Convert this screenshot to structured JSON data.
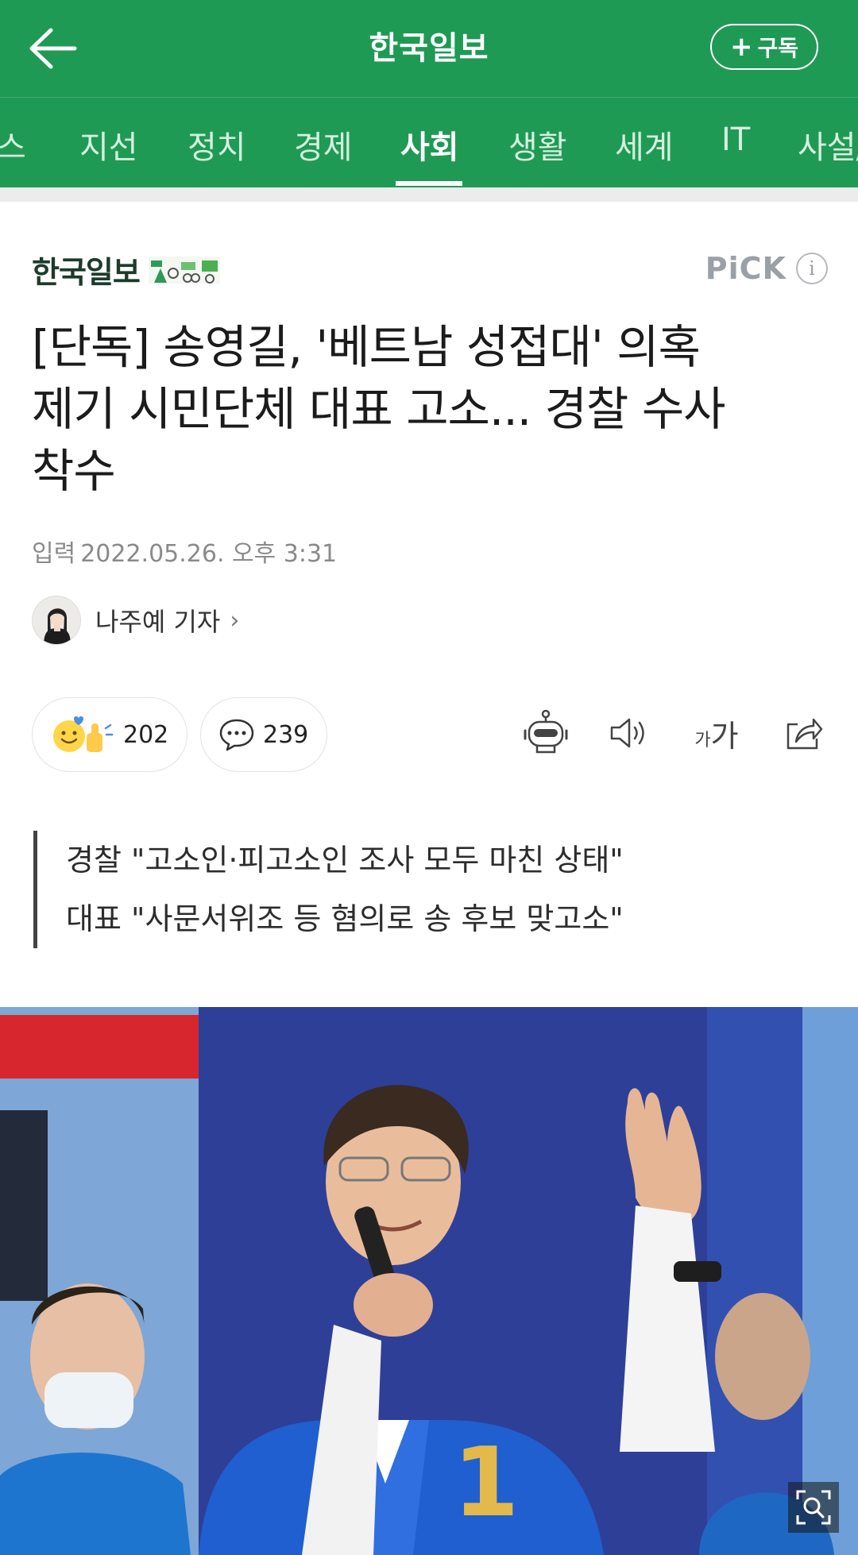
{
  "header": {
    "title": "한국일보",
    "subscribe_label": "구독",
    "back_icon": "back-arrow-icon"
  },
  "tabs": [
    {
      "label": "스",
      "active": false
    },
    {
      "label": "지선",
      "active": false
    },
    {
      "label": "정치",
      "active": false
    },
    {
      "label": "경제",
      "active": false
    },
    {
      "label": "사회",
      "active": true
    },
    {
      "label": "생활",
      "active": false
    },
    {
      "label": "세계",
      "active": false
    },
    {
      "label": "IT",
      "active": false
    },
    {
      "label": "사설/",
      "active": false
    }
  ],
  "article": {
    "press_name": "한국일보",
    "pick_label": "PiCK",
    "info_label": "i",
    "headline_lines": [
      "[단독] 송영길, '베트남 성접대' 의혹",
      "제기 시민단체 대표 고소... 경찰 수사",
      "착수"
    ],
    "date_label": "입력",
    "date_value": "2022.05.26. 오후 3:31",
    "author_name": "나주예 기자",
    "author_chevron": "›",
    "reaction_count": "202",
    "comment_count": "239",
    "font_size_label_small": "가",
    "font_size_label_large": "가",
    "subheadline": [
      "경찰 \"고소인·피고소인 조사 모두 마친 상태\"",
      "대표 \"사문서위조 등 혐의로 송 후보 맞고소\""
    ],
    "photo_jersey_number": "1"
  },
  "colors": {
    "brand_green": "#1f9a55",
    "text_dark": "#1b1b1b",
    "muted": "#8a8a8a"
  }
}
